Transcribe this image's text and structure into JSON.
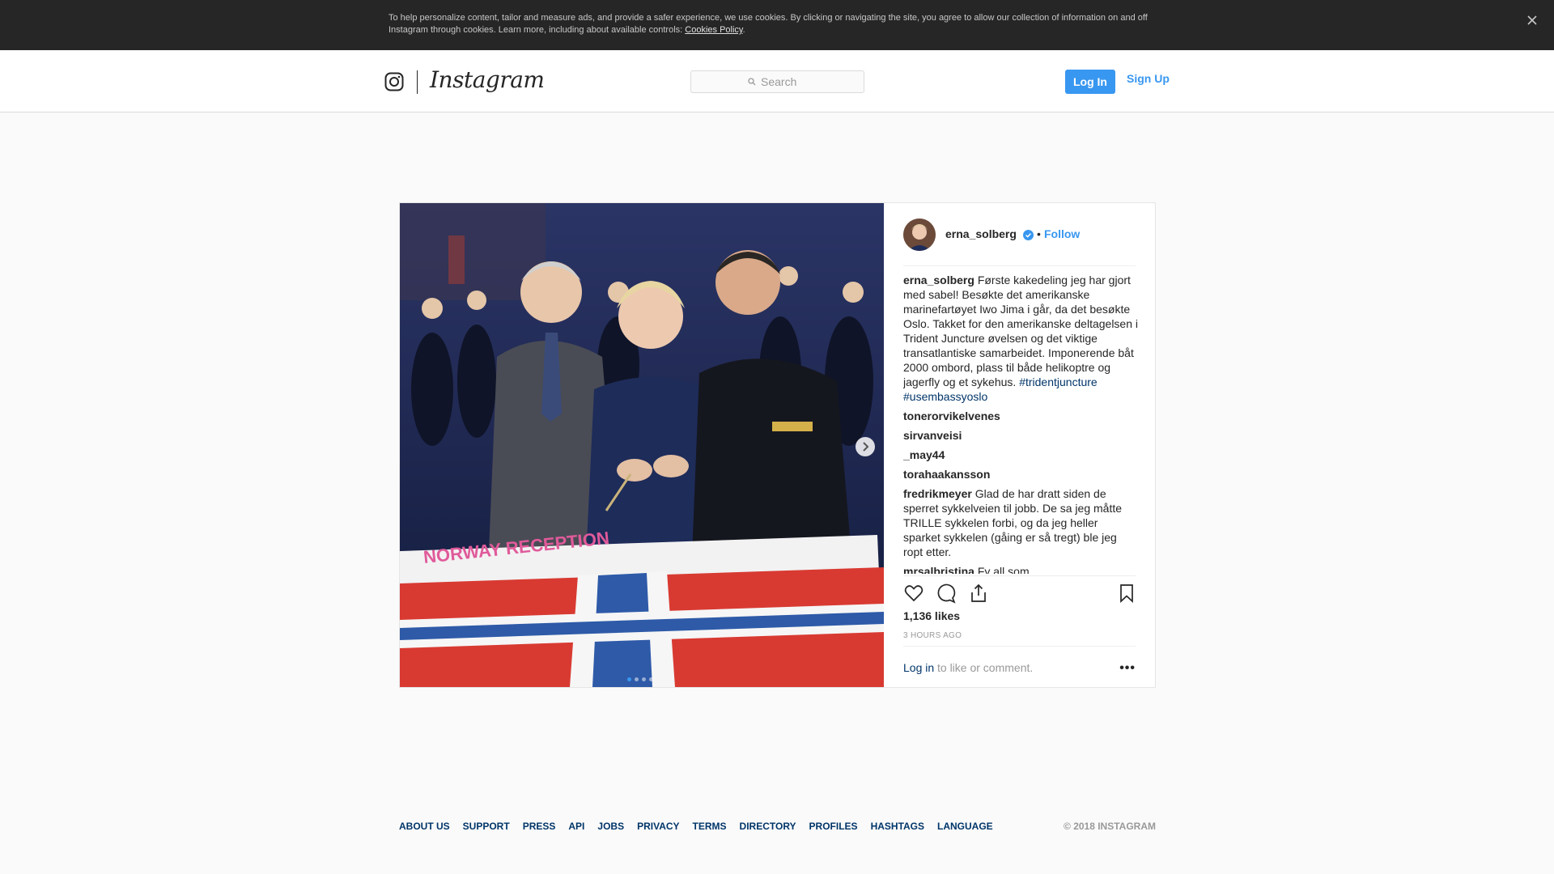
{
  "cookie_banner": {
    "text": "To help personalize content, tailor and measure ads, and provide a safer experience, we use cookies. By clicking or navigating the site, you agree to allow our collection of information on and off Instagram through cookies. Learn more, including about available controls: ",
    "link": "Cookies Policy",
    "end": ".",
    "close_icon": "close-icon"
  },
  "nav": {
    "logo_icon": "instagram-glyph-icon",
    "wordmark": "Instagram",
    "search_placeholder": "Search",
    "login_label": "Log In",
    "signup_label": "Sign Up"
  },
  "post": {
    "username": "erna_solberg",
    "verified": true,
    "bullet": "•",
    "follow_label": "Follow",
    "caption": {
      "user": "erna_solberg",
      "text": " Første kakedeling jeg har gjort med sabel! Besøkte det amerikanske marinefartøyet Iwo Jima i går, da det besøkte Oslo. Takket for den amerikanske deltagelsen i Trident Juncture øvelsen og det viktige transatlantiske samarbeidet. Imponerende båt 2000 ombord, plass til både helikoptre og jagerfly og et sykehus. ",
      "tag1": "#tridentjuncture",
      "tag2": "#usembassyoslo"
    },
    "comments": [
      {
        "user": "tonerorvikelvenes",
        "text": "      "
      },
      {
        "user": "sirvanveisi",
        "text": "          "
      },
      {
        "user": "_may44",
        "text": "          "
      },
      {
        "user": "torahaakansson",
        "text": "        "
      },
      {
        "user": "fredrikmeyer",
        "text": " Glad de har dratt siden de sperret sykkelveien til jobb. De sa jeg måtte TRILLE sykkelen forbi, og da jeg heller sparket sykkelen (gåing er så tregt) ble jeg ropt etter."
      },
      {
        "user": "mrsalbristina",
        "text": " Fy all som"
      }
    ],
    "likes": "1,136 likes",
    "time": "3 HOURS AGO",
    "login_link": "Log in",
    "login_rest": " to like or comment.",
    "more": "•••",
    "carousel_dots": 4,
    "carousel_active": 0,
    "icons": [
      "heart-icon",
      "comment-icon",
      "share-icon",
      "bookmark-icon",
      "chevron-right-icon",
      "verified-badge-icon",
      "search-icon"
    ]
  },
  "footer": {
    "links": [
      "ABOUT US",
      "SUPPORT",
      "PRESS",
      "API",
      "JOBS",
      "PRIVACY",
      "TERMS",
      "DIRECTORY",
      "PROFILES",
      "HASHTAGS",
      "LANGUAGE"
    ],
    "copyright": "© 2018 INSTAGRAM"
  },
  "colors": {
    "accent": "#3897f0",
    "link": "#003569",
    "banner": "#262626",
    "background": "#fafafa"
  }
}
